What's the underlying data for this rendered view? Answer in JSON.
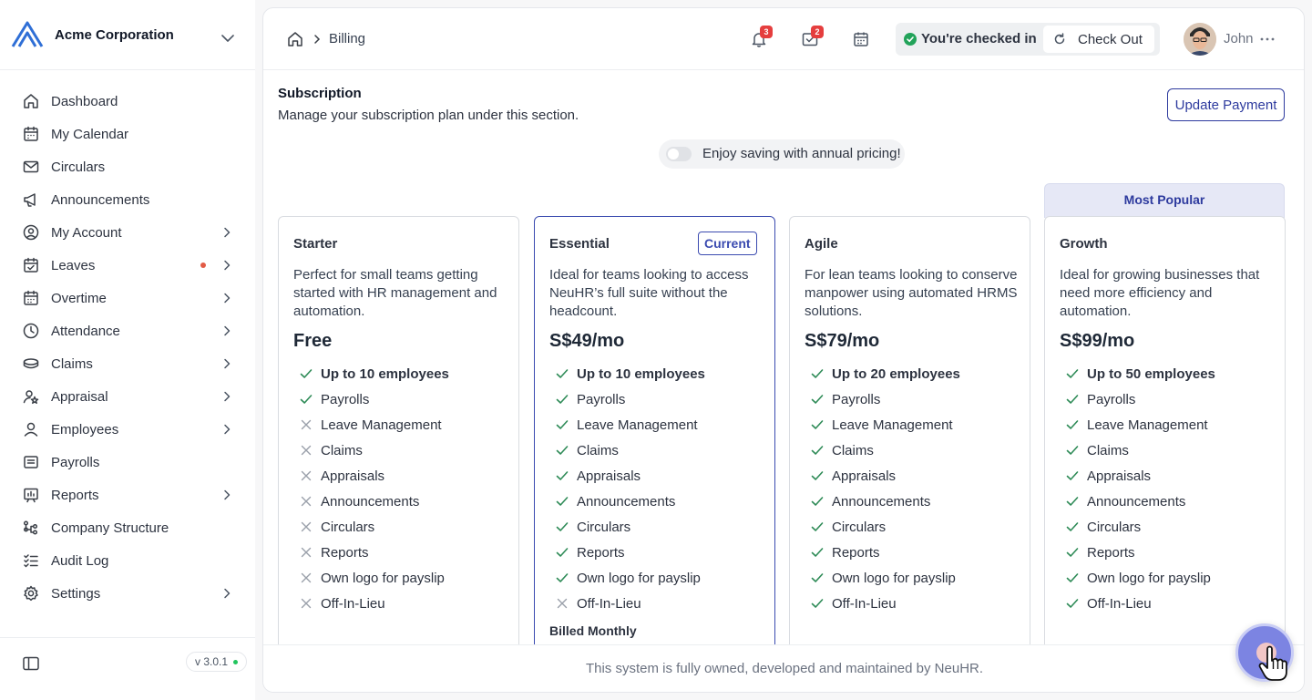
{
  "org": {
    "name": "Acme Corporation"
  },
  "sidebar": {
    "items": [
      {
        "label": "Dashboard",
        "icon": "home-icon",
        "chevron": false
      },
      {
        "label": "My Calendar",
        "icon": "calendar-icon",
        "chevron": false
      },
      {
        "label": "Circulars",
        "icon": "mail-icon",
        "chevron": false
      },
      {
        "label": "Announcements",
        "icon": "megaphone-icon",
        "chevron": false
      },
      {
        "label": "My Account",
        "icon": "user-circle-icon",
        "chevron": true
      },
      {
        "label": "Leaves",
        "icon": "calendar-check-icon",
        "chevron": true,
        "dot": true
      },
      {
        "label": "Overtime",
        "icon": "calendar-clock-icon",
        "chevron": true
      },
      {
        "label": "Attendance",
        "icon": "clock-icon",
        "chevron": true
      },
      {
        "label": "Claims",
        "icon": "coins-icon",
        "chevron": true
      },
      {
        "label": "Appraisal",
        "icon": "user-star-icon",
        "chevron": true
      },
      {
        "label": "Employees",
        "icon": "user-icon",
        "chevron": true
      },
      {
        "label": "Payrolls",
        "icon": "receipt-icon",
        "chevron": false
      },
      {
        "label": "Reports",
        "icon": "report-icon",
        "chevron": true
      },
      {
        "label": "Company Structure",
        "icon": "hierarchy-icon",
        "chevron": false
      },
      {
        "label": "Audit Log",
        "icon": "checklist-icon",
        "chevron": false
      },
      {
        "label": "Settings",
        "icon": "gear-icon",
        "chevron": true
      }
    ],
    "version": "v 3.0.1"
  },
  "breadcrumb": {
    "current": "Billing"
  },
  "topbar": {
    "notifications_count": "3",
    "inbox_count": "2",
    "checked_in_text": "You're checked in",
    "checkout_label": "Check Out",
    "user_name": "John"
  },
  "subscription": {
    "title": "Subscription",
    "subtitle": "Manage your subscription plan under this section.",
    "update_payment_label": "Update Payment",
    "annual_toggle_label": "Enjoy saving with annual pricing!",
    "annual_toggle_on": false,
    "most_popular_label": "Most Popular"
  },
  "feature_names": [
    "Payrolls",
    "Leave Management",
    "Claims",
    "Appraisals",
    "Announcements",
    "Circulars",
    "Reports",
    "Own logo for payslip",
    "Off-In-Lieu"
  ],
  "plans": [
    {
      "name": "Starter",
      "description": "Perfect for small teams getting started with HR management and automation.",
      "price": "Free",
      "employees": "Up to 10 employees",
      "included": [
        true,
        false,
        false,
        false,
        false,
        false,
        false,
        false,
        false
      ],
      "current": false
    },
    {
      "name": "Essential",
      "description": "Ideal for teams looking to access NeuHR’s full suite without the headcount.",
      "price": "S$49/mo",
      "employees": "Up to 10 employees",
      "included": [
        true,
        true,
        true,
        true,
        true,
        true,
        true,
        true,
        false
      ],
      "current": true,
      "current_label": "Current",
      "billed_label": "Billed Monthly"
    },
    {
      "name": "Agile",
      "description": "For lean teams looking to conserve manpower using automated HRMS solutions.",
      "price": "S$79/mo",
      "employees": "Up to 20 employees",
      "included": [
        true,
        true,
        true,
        true,
        true,
        true,
        true,
        true,
        true
      ],
      "current": false
    },
    {
      "name": "Growth",
      "description": "Ideal for growing businesses that need more efficiency and automation.",
      "price": "S$99/mo",
      "employees": "Up to 50 employees",
      "included": [
        true,
        true,
        true,
        true,
        true,
        true,
        true,
        true,
        true
      ],
      "current": false
    }
  ],
  "footer": {
    "text": "This system is fully owned, developed and maintained by NeuHR."
  },
  "colors": {
    "accent": "#2d3a9e",
    "check": "#2e8b57",
    "cross": "#9aa0aa",
    "badge": "#e53e3e"
  }
}
